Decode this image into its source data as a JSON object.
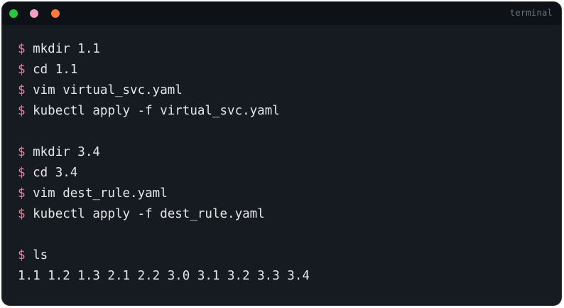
{
  "window": {
    "title": "terminal",
    "buttons": [
      {
        "name": "green",
        "color": "#27c93f"
      },
      {
        "name": "pink",
        "color": "#f2a2c0"
      },
      {
        "name": "orange",
        "color": "#ff7a3d"
      }
    ]
  },
  "terminal": {
    "prompt": "$",
    "lines": [
      {
        "type": "command",
        "text": "mkdir 1.1"
      },
      {
        "type": "command",
        "text": "cd 1.1"
      },
      {
        "type": "command",
        "text": "vim virtual_svc.yaml"
      },
      {
        "type": "command",
        "text": "kubectl apply -f virtual_svc.yaml"
      },
      {
        "type": "blank",
        "text": ""
      },
      {
        "type": "command",
        "text": "mkdir 3.4"
      },
      {
        "type": "command",
        "text": "cd 3.4"
      },
      {
        "type": "command",
        "text": "vim dest_rule.yaml"
      },
      {
        "type": "command",
        "text": "kubectl apply -f dest_rule.yaml"
      },
      {
        "type": "blank",
        "text": ""
      },
      {
        "type": "command",
        "text": "ls"
      },
      {
        "type": "output",
        "text": "1.1 1.2 1.3 2.1 2.2 3.0 3.1 3.2 3.3 3.4"
      }
    ]
  }
}
